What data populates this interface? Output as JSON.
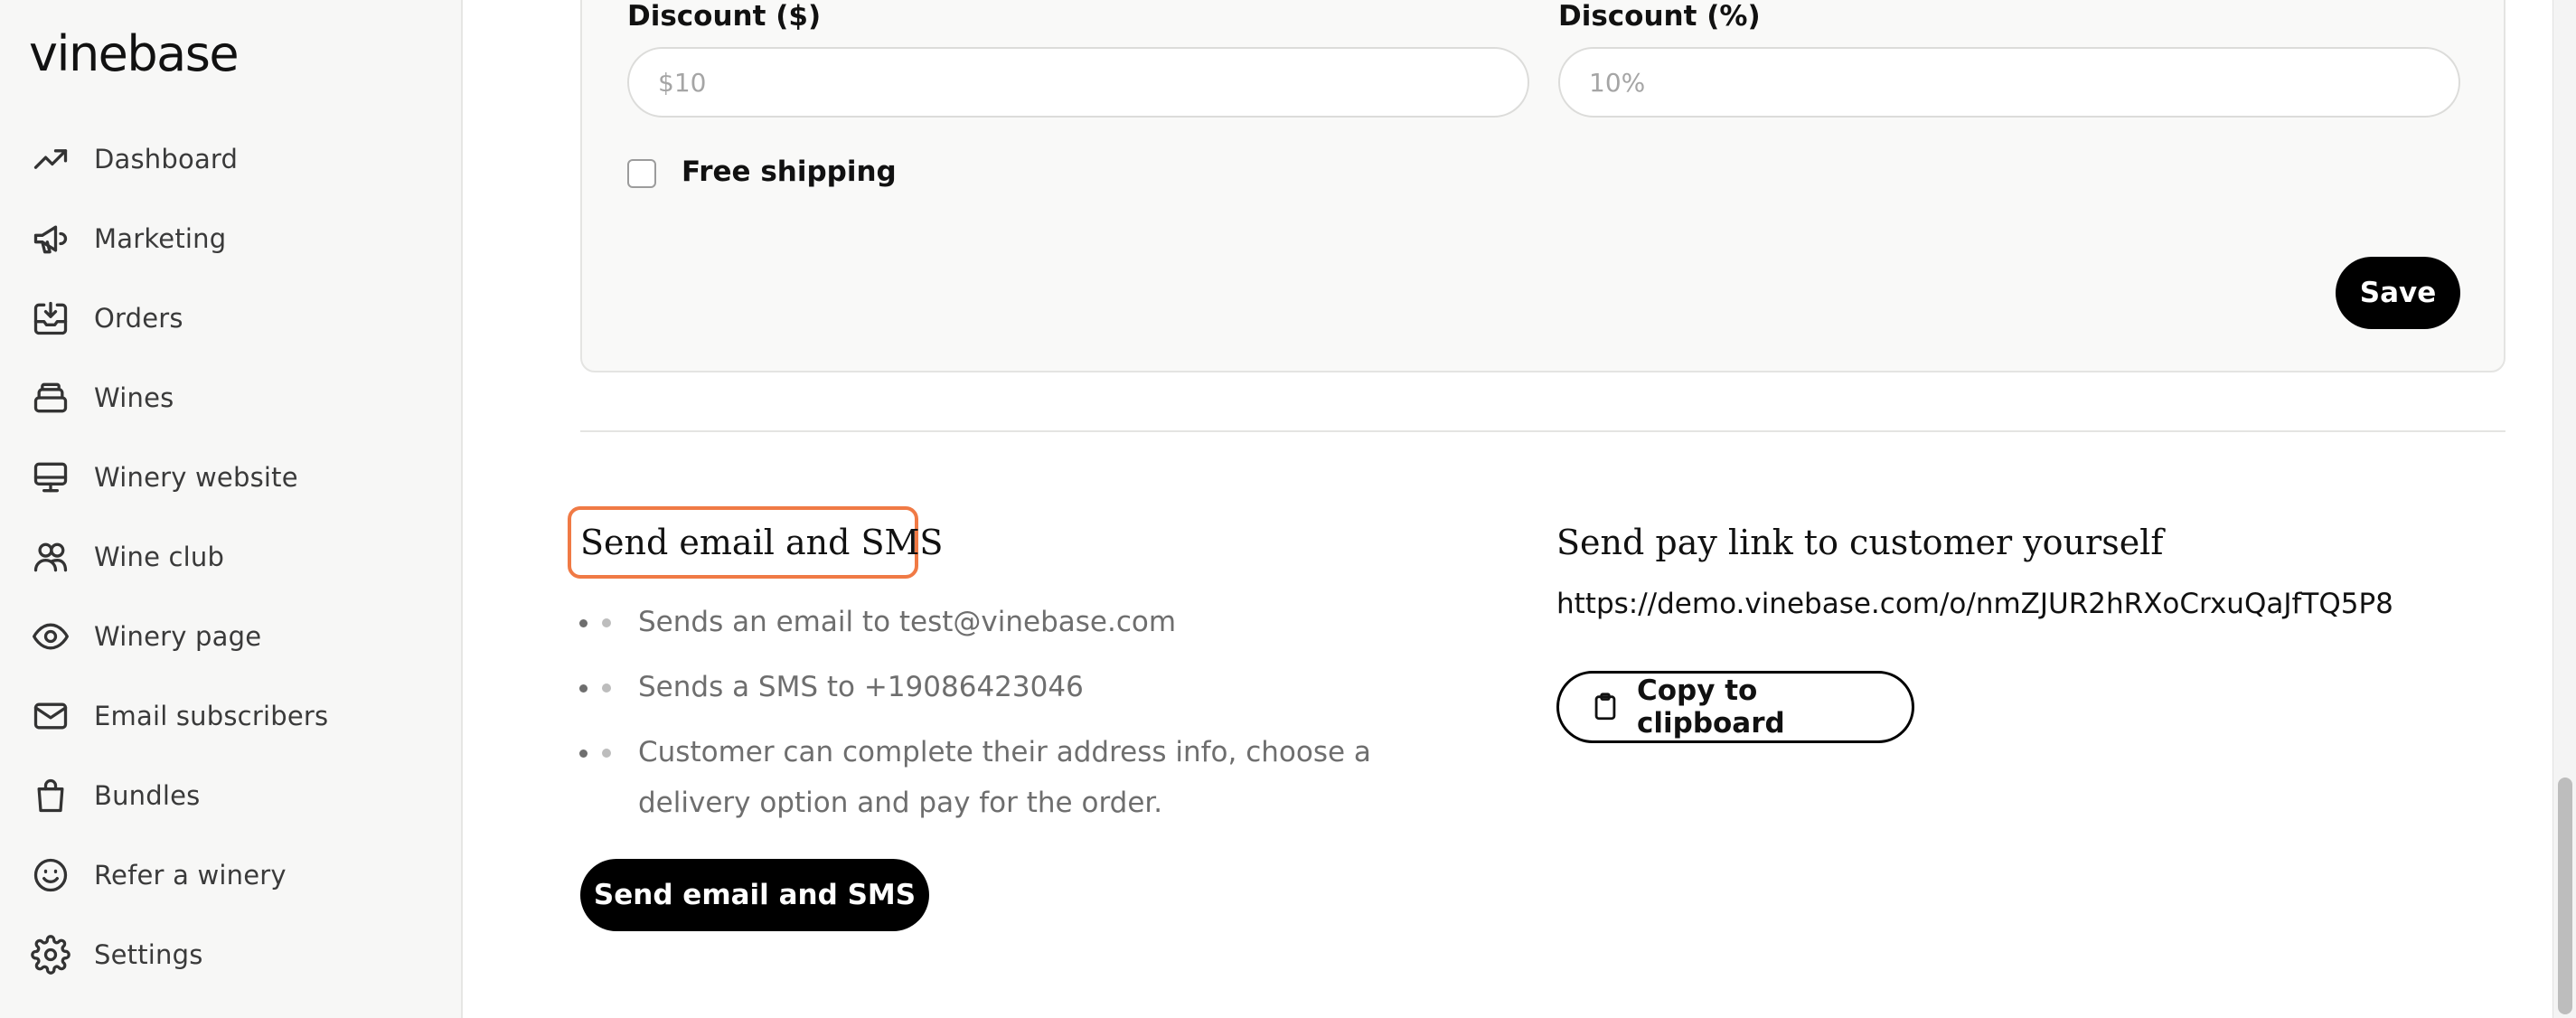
{
  "brand": {
    "name": "vinebase"
  },
  "sidebar": {
    "items": [
      {
        "label": "Dashboard",
        "icon": "trending-up-icon"
      },
      {
        "label": "Marketing",
        "icon": "megaphone-icon"
      },
      {
        "label": "Orders",
        "icon": "inbox-download-icon"
      },
      {
        "label": "Wines",
        "icon": "stack-icon"
      },
      {
        "label": "Winery website",
        "icon": "monitor-icon"
      },
      {
        "label": "Wine club",
        "icon": "users-icon"
      },
      {
        "label": "Winery page",
        "icon": "eye-icon"
      },
      {
        "label": "Email subscribers",
        "icon": "envelope-icon"
      },
      {
        "label": "Bundles",
        "icon": "shopping-bag-icon"
      },
      {
        "label": "Refer a winery",
        "icon": "smiley-icon"
      },
      {
        "label": "Settings",
        "icon": "gear-icon"
      }
    ]
  },
  "discount_card": {
    "amount_label": "Discount ($)",
    "amount_placeholder": "$10",
    "percent_label": "Discount (%)",
    "percent_placeholder": "10%",
    "free_shipping_label": "Free shipping",
    "free_shipping_checked": false,
    "save_label": "Save"
  },
  "send_section": {
    "title": "Send email and SMS",
    "bullets": [
      "Sends an email to test@vinebase.com",
      "Sends a SMS to +19086423046",
      "Customer can complete their address info, choose a delivery option and pay for the order."
    ],
    "button_label": "Send email and SMS",
    "highlight_color": "#f07a45"
  },
  "paylink_section": {
    "title": "Send pay link to customer yourself",
    "url": "https://demo.vinebase.com/o/nmZJUR2hRXoCrxuQaJfTQ5P8",
    "copy_label": "Copy to clipboard"
  }
}
